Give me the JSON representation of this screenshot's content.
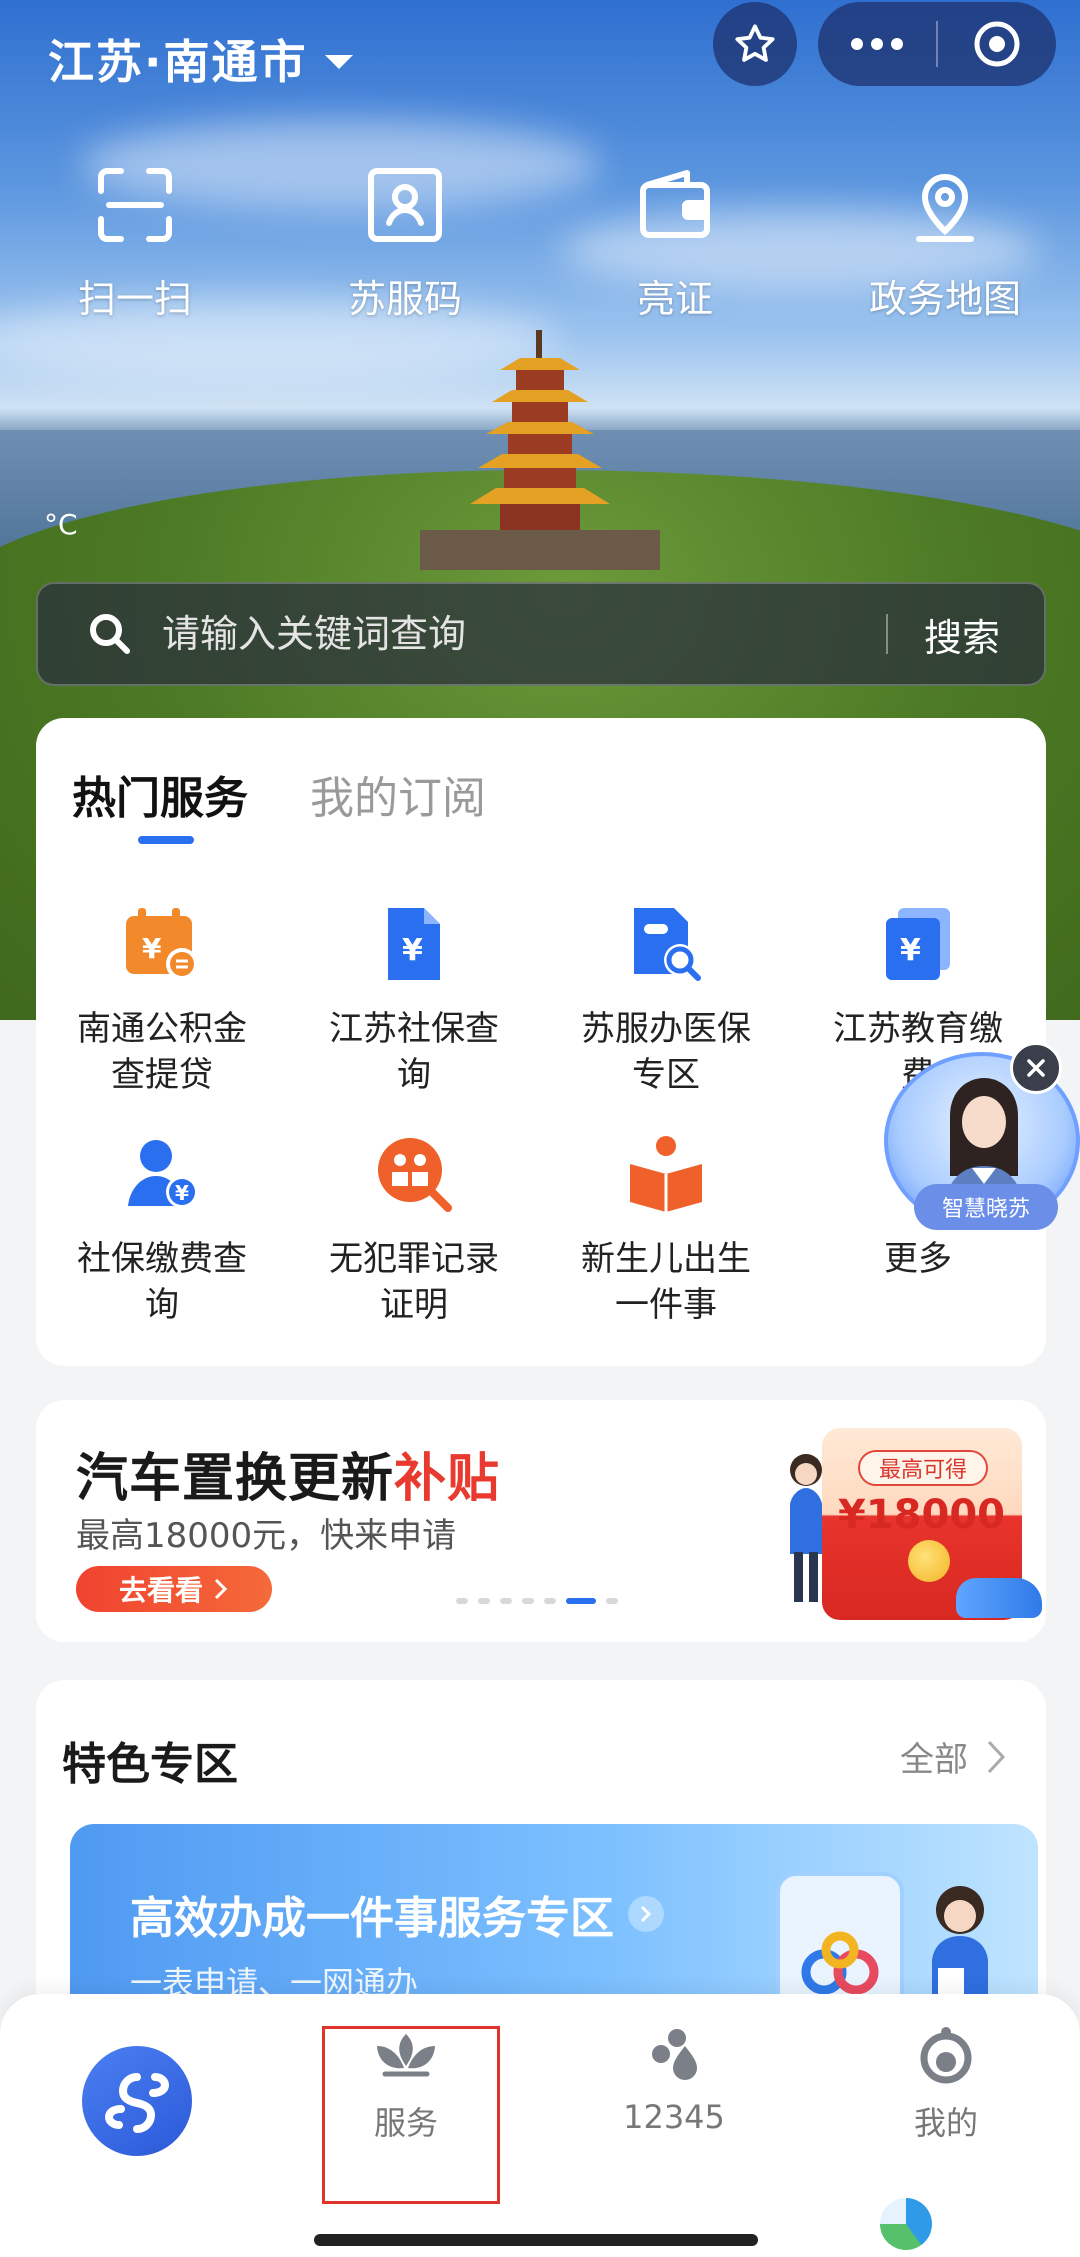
{
  "header": {
    "city": "江苏·南通市"
  },
  "quick_actions": [
    {
      "label": "扫一扫",
      "icon": "scan-icon"
    },
    {
      "label": "苏服码",
      "icon": "id-card-icon"
    },
    {
      "label": "亮证",
      "icon": "wallet-icon"
    },
    {
      "label": "政务地图",
      "icon": "map-pin-icon"
    }
  ],
  "weather": {
    "temperature": "°C"
  },
  "search": {
    "placeholder": "请输入关键词查询",
    "button": "搜索"
  },
  "services": {
    "tabs": [
      {
        "label": "热门服务",
        "active": true
      },
      {
        "label": "我的订阅",
        "active": false
      }
    ],
    "items": [
      {
        "label": "南通公积金\n查提贷",
        "icon": "calendar-yuan-icon",
        "color": "#f28a2b"
      },
      {
        "label": "江苏社保查\n询",
        "icon": "document-yuan-icon",
        "color": "#2a6ff0"
      },
      {
        "label": "苏服办医保\n专区",
        "icon": "document-search-icon",
        "color": "#2a6ff0"
      },
      {
        "label": "江苏教育缴\n费",
        "icon": "stack-yuan-icon",
        "color": "#2a6ff0"
      },
      {
        "label": "社保缴费查\n询",
        "icon": "user-yuan-icon",
        "color": "#2a6ff0"
      },
      {
        "label": "无犯罪记录\n证明",
        "icon": "people-search-icon",
        "color": "#f0602a"
      },
      {
        "label": "新生儿出生\n一件事",
        "icon": "baby-book-icon",
        "color": "#f0602a"
      },
      {
        "label": "更多",
        "icon": "more-icon",
        "color": "#2a6ff0"
      }
    ]
  },
  "banner": {
    "title_main": "汽车置换更新",
    "title_accent": "补贴",
    "subtitle": "最高18000元，快来申请",
    "button": "去看看",
    "badge": "最高可得",
    "amount": "¥18000",
    "active_dot": 5,
    "dot_count": 7
  },
  "featured": {
    "title": "特色专区",
    "all_label": "全部",
    "panel_title": "高效办成一件事服务专区",
    "panel_subtitle": "一表申请、一网通办"
  },
  "assistant": {
    "label": "智慧晓苏"
  },
  "tabbar": {
    "items": [
      {
        "label": "",
        "icon": "app-logo-icon"
      },
      {
        "label": "服务",
        "icon": "lotus-icon"
      },
      {
        "label": "12345",
        "icon": "drops-icon"
      },
      {
        "label": "我的",
        "icon": "user-icon"
      }
    ],
    "highlighted": "服务"
  },
  "colors": {
    "accent": "#2a6ff0",
    "orange": "#f28a2b",
    "red": "#e83a2e"
  }
}
